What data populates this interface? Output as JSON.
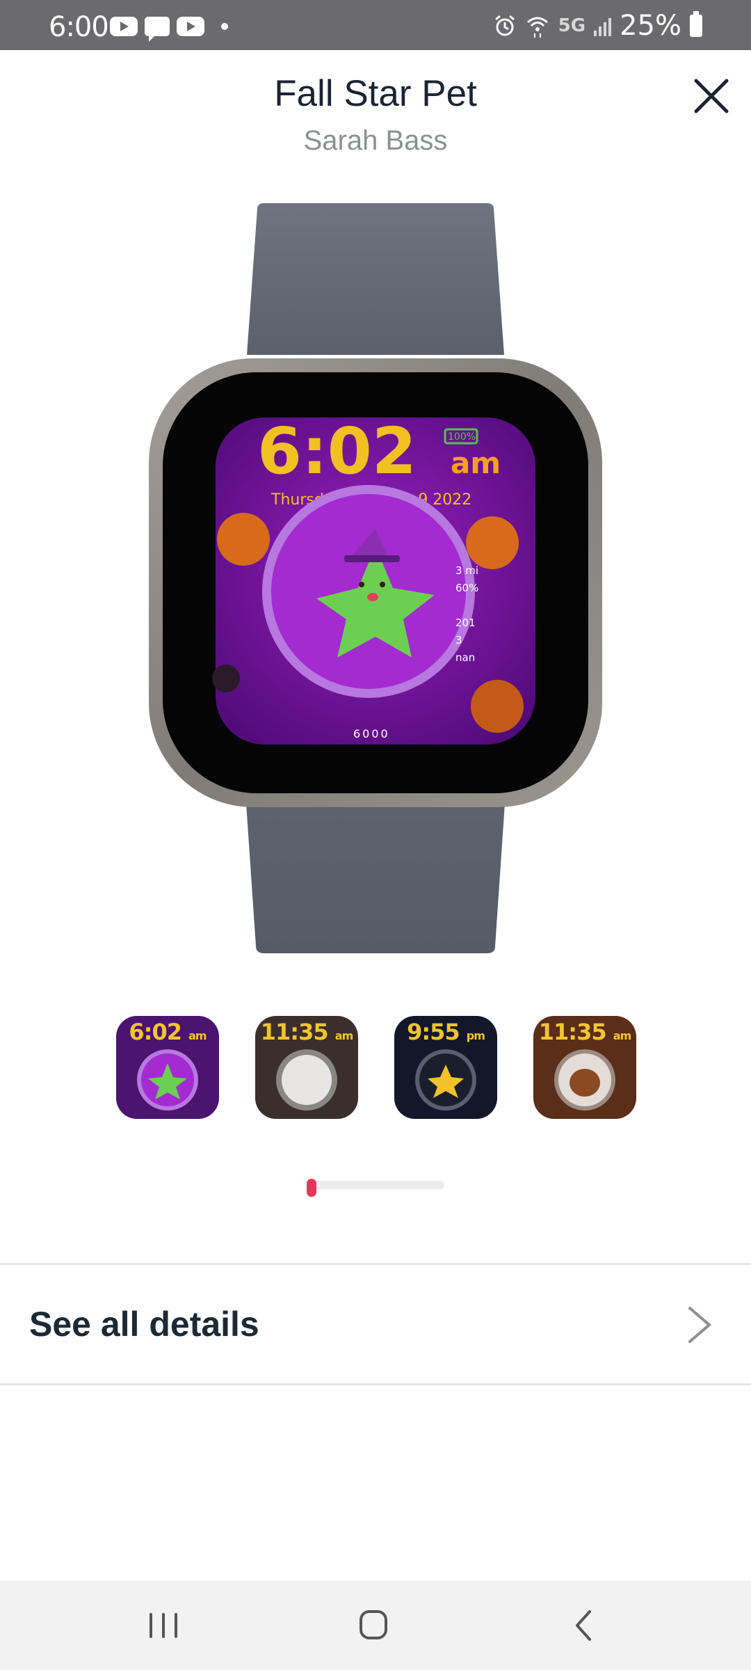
{
  "status_bar": {
    "time": "6:00",
    "network": "5G",
    "battery": "25%",
    "icons": [
      "youtube-icon",
      "message-icon",
      "youtube-icon",
      "alarm-icon",
      "wifi-icon",
      "signal-icon",
      "battery-icon"
    ]
  },
  "header": {
    "title": "Fall Star Pet",
    "author": "Sarah Bass"
  },
  "preview": {
    "time": "6:02",
    "ampm": "am",
    "date": "Thursday, October 9 2022",
    "battery": "100%",
    "stats": [
      "3 mi",
      "60%",
      "",
      "201",
      "3",
      "nan"
    ],
    "steps": "6000"
  },
  "thumbnails": [
    {
      "time": "6:02",
      "ampm": "am",
      "bg": "#4a1470"
    },
    {
      "time": "11:35",
      "ampm": "am",
      "bg": "#3a2f2a"
    },
    {
      "time": "9:55",
      "ampm": "pm",
      "bg": "#12182a"
    },
    {
      "time": "11:35",
      "ampm": "am",
      "bg": "#5a2e18"
    }
  ],
  "pager": {
    "active_index": 0
  },
  "details": {
    "label": "See all details"
  },
  "colors": {
    "accent": "#e6375b",
    "title": "#1b2433",
    "subtitle": "#8c8f93"
  }
}
